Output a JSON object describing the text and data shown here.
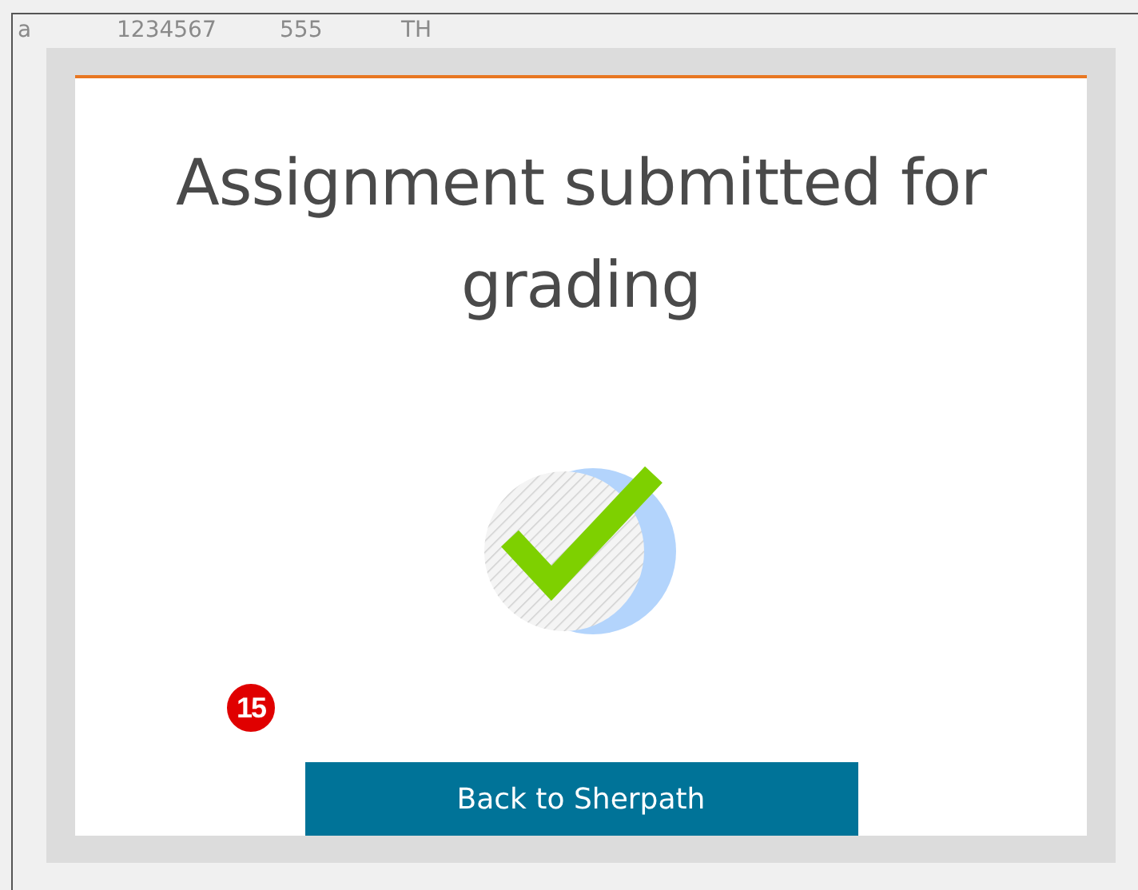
{
  "background_table": {
    "values": [
      "a",
      "1234567",
      "555",
      "TH"
    ]
  },
  "dialog": {
    "title": "Assignment submitted for grading",
    "button": "Back to Sherpath",
    "step_badge": "15"
  }
}
